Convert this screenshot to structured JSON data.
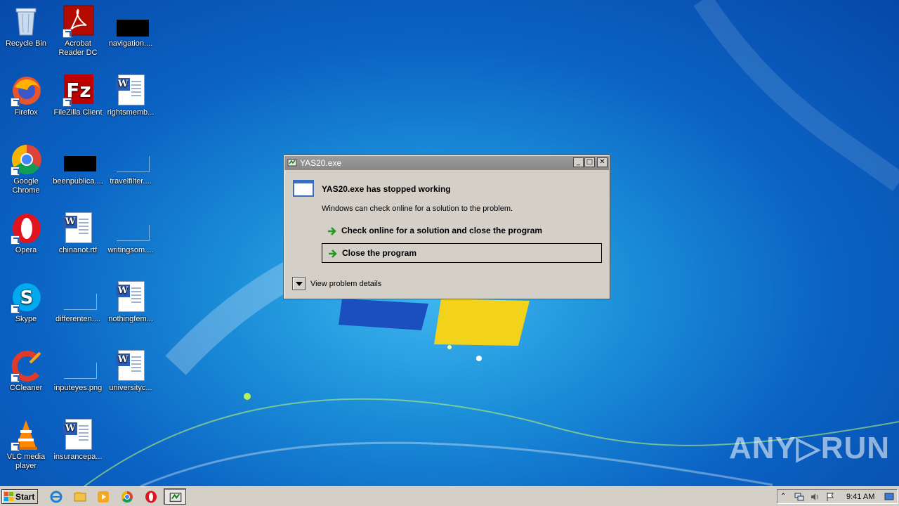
{
  "desktop": {
    "icons": [
      {
        "label": "Recycle Bin"
      },
      {
        "label": "Acrobat Reader DC"
      },
      {
        "label": "navigation...."
      },
      {
        "label": "Firefox"
      },
      {
        "label": "FileZilla Client"
      },
      {
        "label": "rightsmemb..."
      },
      {
        "label": "Google Chrome"
      },
      {
        "label": "beenpublica...."
      },
      {
        "label": "travelfilter...."
      },
      {
        "label": "Opera"
      },
      {
        "label": "chinanot.rtf"
      },
      {
        "label": "writingsom...."
      },
      {
        "label": "Skype"
      },
      {
        "label": "differenten...."
      },
      {
        "label": "nothingfem..."
      },
      {
        "label": "CCleaner"
      },
      {
        "label": "inputeyes.png"
      },
      {
        "label": "universityc..."
      },
      {
        "label": "VLC media player"
      },
      {
        "label": "insurancepa..."
      }
    ]
  },
  "dialog": {
    "title": "YAS20.exe",
    "heading": "YAS20.exe has stopped working",
    "subtext": "Windows can check online for a solution to the problem.",
    "options": [
      {
        "label": "Check online for a solution and close the program",
        "selected": false
      },
      {
        "label": "Close the program",
        "selected": true
      }
    ],
    "details_label": "View problem details",
    "minimize": "_",
    "maximize": "□",
    "close": "✕"
  },
  "taskbar": {
    "start_label": "Start",
    "clock": "9:41 AM"
  },
  "watermark": "ANY▷RUN"
}
